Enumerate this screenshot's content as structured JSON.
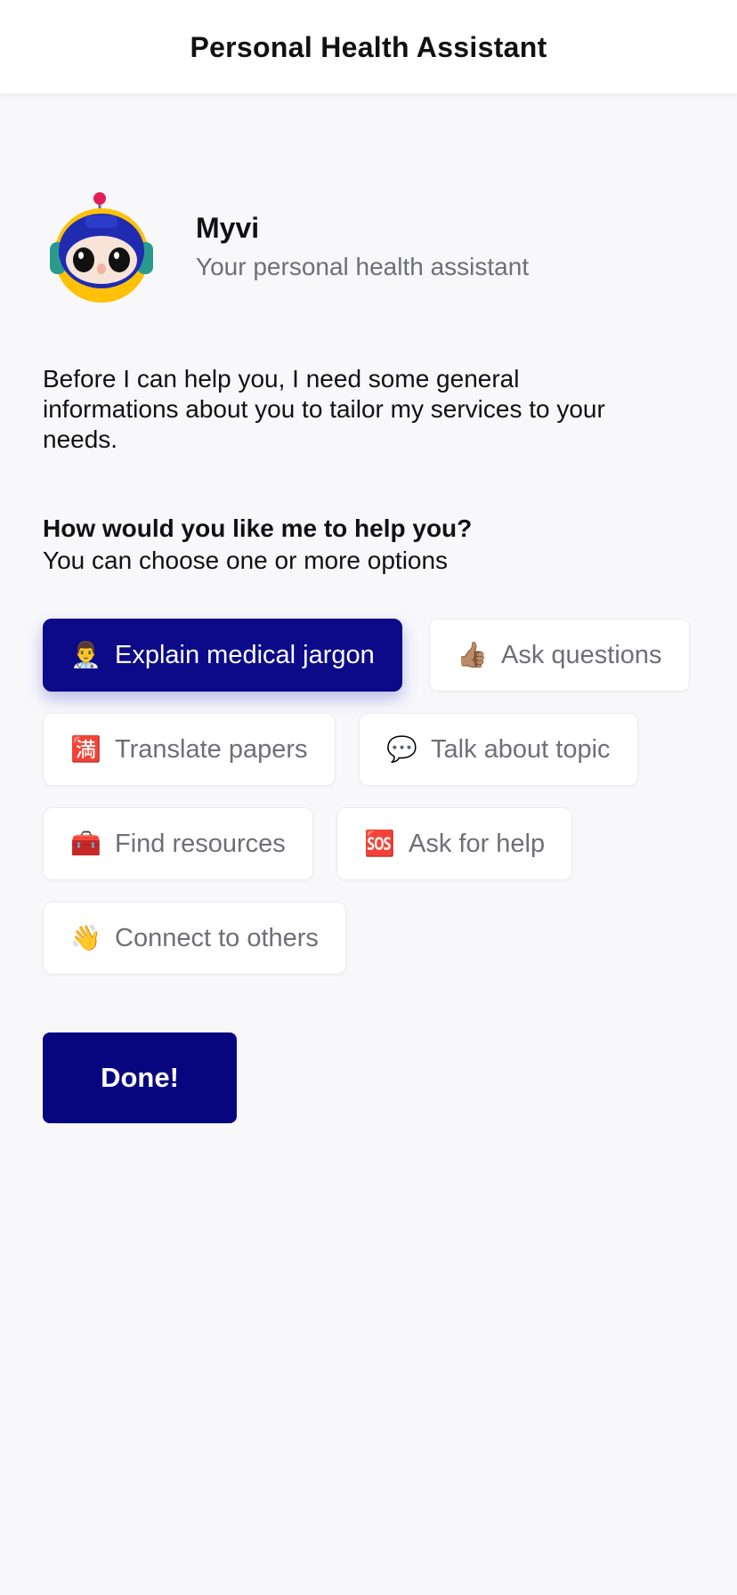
{
  "header": {
    "title": "Personal Health Assistant"
  },
  "assistant": {
    "name": "Myvi",
    "tagline": "Your personal health assistant"
  },
  "intro": {
    "text": "Before I can help you, I need some general informations about you to tailor my services to your needs."
  },
  "question": {
    "title": "How would you like me to help you?",
    "subtitle": "You can choose one or more options"
  },
  "options": [
    {
      "emoji": "👨‍⚕️",
      "label": "Explain medical jargon",
      "selected": true
    },
    {
      "emoji": "👍🏽",
      "label": "Ask questions",
      "selected": false
    },
    {
      "emoji": "🈵",
      "label": "Translate papers",
      "selected": false
    },
    {
      "emoji": "💬",
      "label": "Talk about topic",
      "selected": false
    },
    {
      "emoji": "🧰",
      "label": "Find resources",
      "selected": false
    },
    {
      "emoji": "🆘",
      "label": "Ask for help",
      "selected": false
    },
    {
      "emoji": "👋",
      "label": "Connect to others",
      "selected": false
    }
  ],
  "done_button": {
    "label": "Done!"
  },
  "colors": {
    "accent": "#0c0a88",
    "background": "#f8f8fb",
    "muted_text": "#6e6f77"
  }
}
